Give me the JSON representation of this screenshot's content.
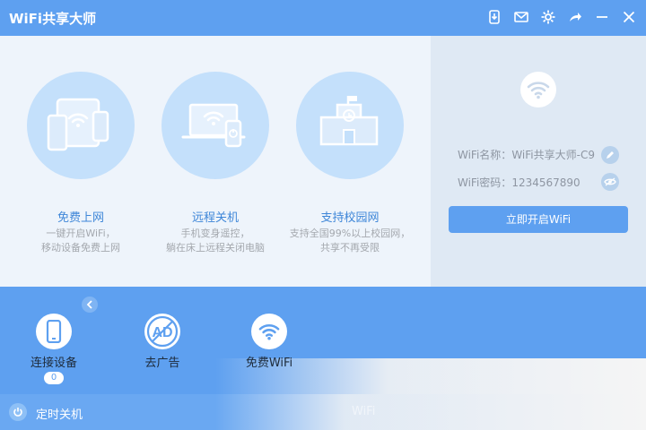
{
  "app": {
    "title": "WiFi共享大师"
  },
  "features": [
    {
      "title": "免费上网",
      "desc1": "一键开启WiFi，",
      "desc2": "移动设备免费上网"
    },
    {
      "title": "远程关机",
      "desc1": "手机变身遥控，",
      "desc2": "躺在床上远程关闭电脑"
    },
    {
      "title": "支持校园网",
      "desc1": "支持全国99%以上校园网，",
      "desc2": "共享不再受限"
    }
  ],
  "panel": {
    "ssid_label": "WiFi名称：",
    "ssid_value": "WiFi共享大师-C9",
    "pwd_label": "WiFi密码：",
    "pwd_value": "1234567890",
    "open_button": "立即开启WiFi"
  },
  "tools": [
    {
      "label": "连接设备",
      "count": "0"
    },
    {
      "label": "去广告"
    },
    {
      "label": "免费WiFi"
    }
  ],
  "tool_icon_text": {
    "ad": "AD"
  },
  "status": {
    "timer_label": "定时关机",
    "faint_text": "WiFi"
  },
  "colors": {
    "accent": "#5ea0f0",
    "feature_circle": "#c4e0fb",
    "panel_bg": "#dfe9f4",
    "feature_title": "#3e86d8"
  },
  "icons": [
    "download-icon",
    "mail-icon",
    "gear-icon",
    "share-icon",
    "minimize-icon",
    "close-icon",
    "wifi-icon",
    "edit-icon",
    "eye-icon",
    "chevron-left-icon",
    "phone-icon",
    "no-ad-icon",
    "power-icon"
  ]
}
